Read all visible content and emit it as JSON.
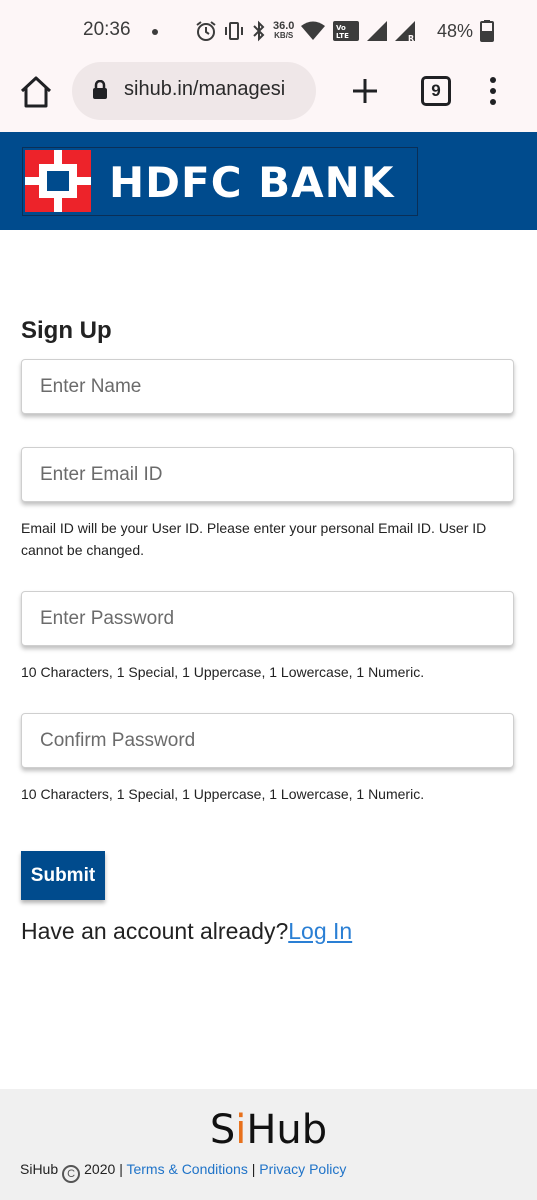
{
  "status_bar": {
    "time": "20:36",
    "network_speed_value": "36.0",
    "network_speed_unit": "KB/S",
    "volte_label": "Vo LTE",
    "battery_percent": "48%"
  },
  "browser": {
    "url": "sihub.in/managesi",
    "tab_count": "9"
  },
  "header": {
    "bank_name": "HDFC BANK",
    "brand_color": "#004b8d"
  },
  "form": {
    "title": "Sign Up",
    "name_placeholder": "Enter Name",
    "email_placeholder": "Enter Email ID",
    "email_hint": "Email ID will be your User ID. Please enter your personal Email ID. User ID cannot be changed.",
    "password_placeholder": "Enter Password",
    "password_hint": "10 Characters, 1 Special, 1 Uppercase, 1 Lowercase, 1 Numeric.",
    "confirm_placeholder": "Confirm Password",
    "confirm_hint": "10 Characters, 1 Special, 1 Uppercase, 1 Lowercase, 1 Numeric.",
    "submit_label": "Submit",
    "login_prompt": "Have an account already?",
    "login_link": "Log In"
  },
  "footer": {
    "logo_s": "S",
    "logo_i": "i",
    "logo_rest": "Hub",
    "owner": "SiHub",
    "year": "2020",
    "separator": "|",
    "terms_link": "Terms & Conditions",
    "privacy_link": "Privacy Policy",
    "accent_color": "#e8711c"
  }
}
